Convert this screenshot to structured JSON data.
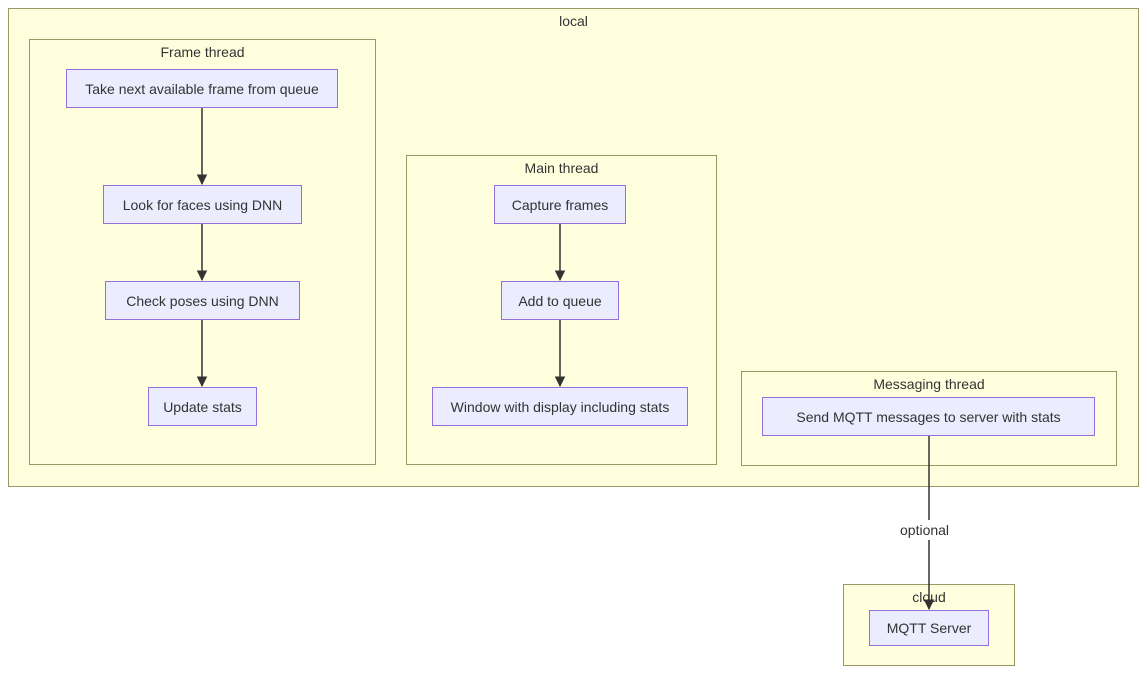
{
  "local": {
    "title": "local",
    "frame_thread": {
      "title": "Frame thread",
      "n1": "Take next available frame from queue",
      "n2": "Look for faces using DNN",
      "n3": "Check poses using DNN",
      "n4": "Update stats"
    },
    "main_thread": {
      "title": "Main thread",
      "n1": "Capture frames",
      "n2": "Add to queue",
      "n3": "Window with display including stats"
    },
    "messaging_thread": {
      "title": "Messaging thread",
      "n1": "Send MQTT messages to server with stats"
    }
  },
  "cloud": {
    "title": "cloud",
    "n1": "MQTT Server"
  },
  "edge_label": "optional"
}
